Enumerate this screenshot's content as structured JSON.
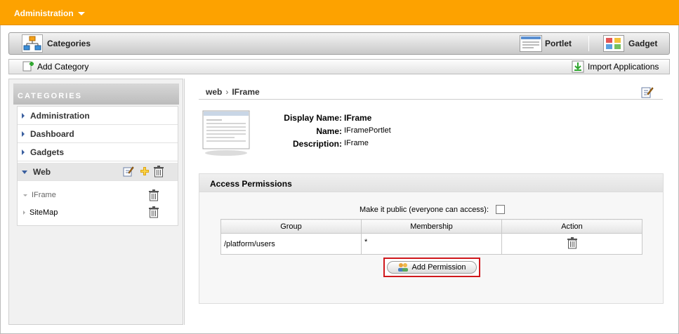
{
  "topbar": {
    "title": "Administration"
  },
  "appbar": {
    "categories_label": "Categories",
    "portlet_label": "Portlet",
    "gadget_label": "Gadget"
  },
  "toolbar": {
    "add_category_label": "Add Category",
    "import_label": "Import Applications"
  },
  "sidebar": {
    "heading": "CATEGORIES",
    "items": [
      {
        "label": "Administration"
      },
      {
        "label": "Dashboard"
      },
      {
        "label": "Gadgets"
      },
      {
        "label": "Web"
      }
    ],
    "subitems": [
      {
        "label": "IFrame"
      },
      {
        "label": "SiteMap"
      }
    ]
  },
  "breadcrumb": {
    "parent": "web",
    "current": "IFrame"
  },
  "details": {
    "display_name_label": "Display Name:",
    "display_name_value": "IFrame",
    "name_label": "Name:",
    "name_value": "IFramePortlet",
    "description_label": "Description:",
    "description_value": "IFrame"
  },
  "permissions": {
    "heading": "Access Permissions",
    "public_label": "Make it public (everyone can access):",
    "columns": [
      "Group",
      "Membership",
      "Action"
    ],
    "rows": [
      {
        "group": "/platform/users",
        "membership": "*"
      }
    ],
    "add_button": "Add Permission"
  },
  "colors": {
    "brand_orange": "#fda200",
    "highlight_red": "#d0181c",
    "arrow_blue": "#3a5f9f"
  },
  "icons": [
    "org-chart-icon",
    "portlet-icon",
    "gadget-icon",
    "add-icon",
    "import-icon",
    "edit-icon",
    "add-plus-icon",
    "trash-icon",
    "iframe-thumbnail-icon",
    "users-icon"
  ]
}
